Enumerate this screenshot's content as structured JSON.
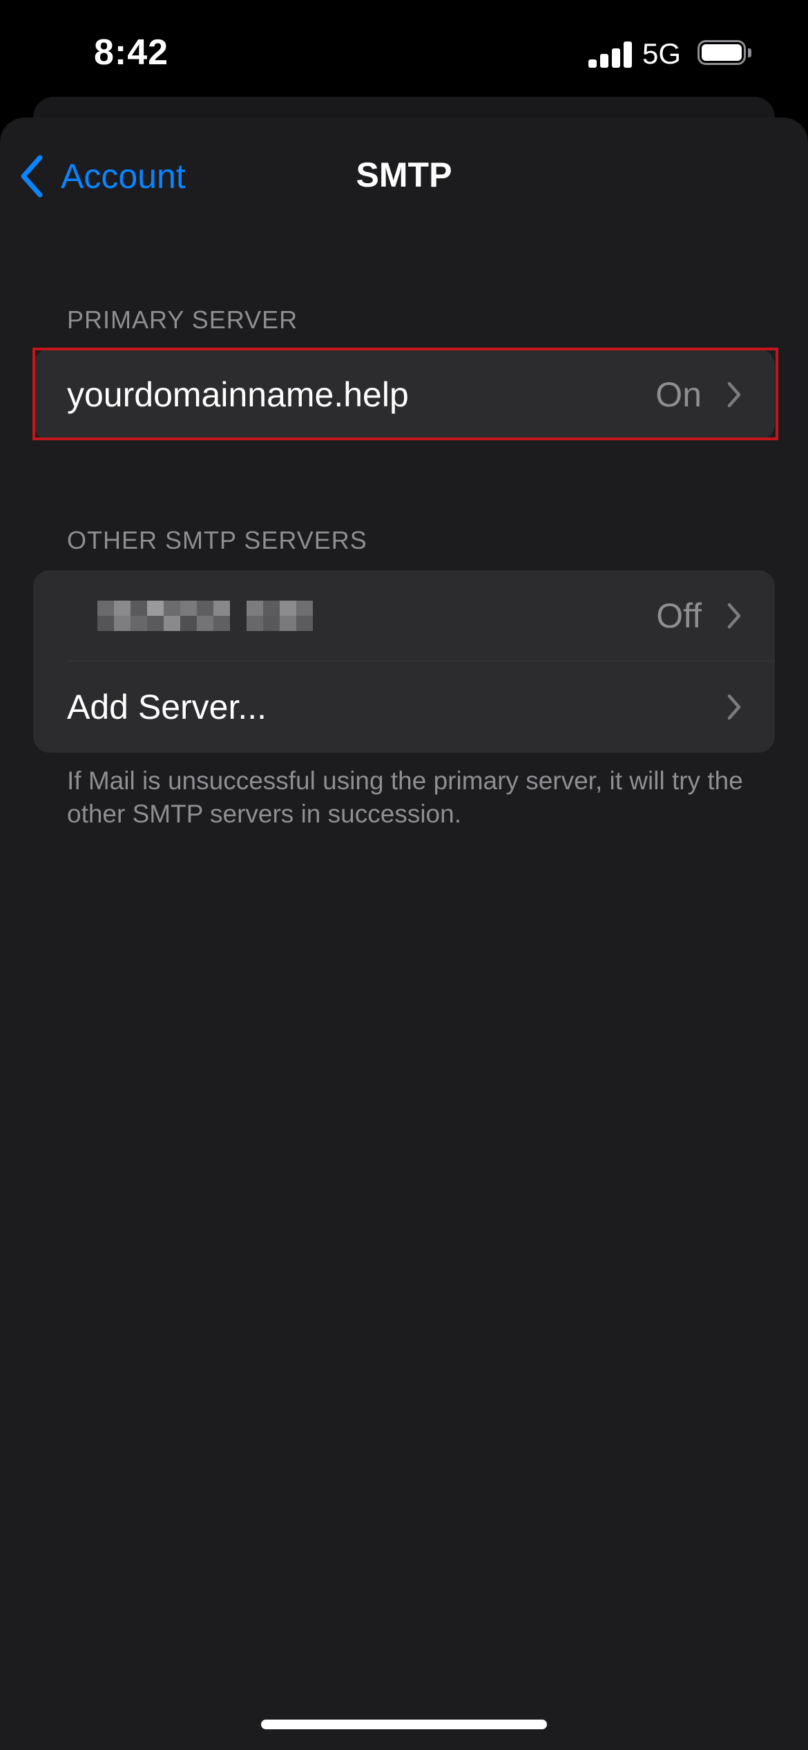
{
  "status_bar": {
    "time": "8:42",
    "network": "5G",
    "icons": [
      "cellular-signal-icon",
      "battery-icon"
    ]
  },
  "nav": {
    "back_label": "Account",
    "back_icon": "chevron-left-icon",
    "title": "SMTP"
  },
  "primary_server": {
    "header": "PRIMARY SERVER",
    "rows": [
      {
        "label": "yourdomainname.help",
        "value": "On",
        "icon": "chevron-right-icon"
      }
    ]
  },
  "other_servers": {
    "header": "OTHER SMTP SERVERS",
    "rows": [
      {
        "label": "",
        "redacted": true,
        "value": "Off",
        "icon": "chevron-right-icon"
      },
      {
        "label": "Add Server...",
        "value": "",
        "icon": "chevron-right-icon"
      }
    ],
    "footer": "If Mail is unsuccessful using the primary server, it will try the other SMTP servers in succession."
  },
  "colors": {
    "background": "#1c1c1e",
    "cell": "#2c2c2e",
    "accent": "#0a84ff",
    "secondary_text": "#8e8e93",
    "highlight": "#c4161c"
  }
}
